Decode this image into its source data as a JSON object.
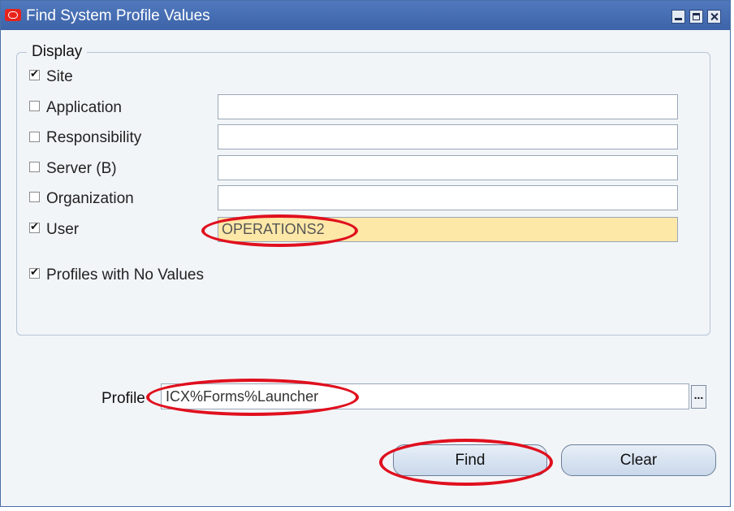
{
  "window": {
    "title": "Find System Profile Values",
    "controls": {
      "minimize": "minimize-icon",
      "maximize": "maximize-icon",
      "close": "close-icon"
    },
    "app_icon": "oracle-icon"
  },
  "display_group": {
    "legend": "Display",
    "options": [
      {
        "key": "site",
        "label": "Site",
        "checked": true,
        "has_field": false,
        "value": ""
      },
      {
        "key": "application",
        "label": "Application",
        "checked": false,
        "has_field": true,
        "value": ""
      },
      {
        "key": "responsibility",
        "label": "Responsibility",
        "checked": false,
        "has_field": true,
        "value": ""
      },
      {
        "key": "server",
        "label": "Server (B)",
        "checked": false,
        "has_field": true,
        "value": ""
      },
      {
        "key": "organization",
        "label": "Organization",
        "checked": false,
        "has_field": true,
        "value": ""
      },
      {
        "key": "user",
        "label": "User",
        "checked": true,
        "has_field": true,
        "value": "OPERATIONS2"
      }
    ],
    "profiles_no_values": {
      "label": "Profiles with No Values",
      "checked": true
    }
  },
  "profile": {
    "label": "Profile",
    "value": "ICX%Forms%Launcher",
    "lov_button": "..."
  },
  "buttons": {
    "find": "Find",
    "clear": "Clear"
  },
  "colors": {
    "titlebar": "#4a6fb4",
    "highlighted_field": "#fde8a8",
    "annotation": "#e0101e"
  }
}
